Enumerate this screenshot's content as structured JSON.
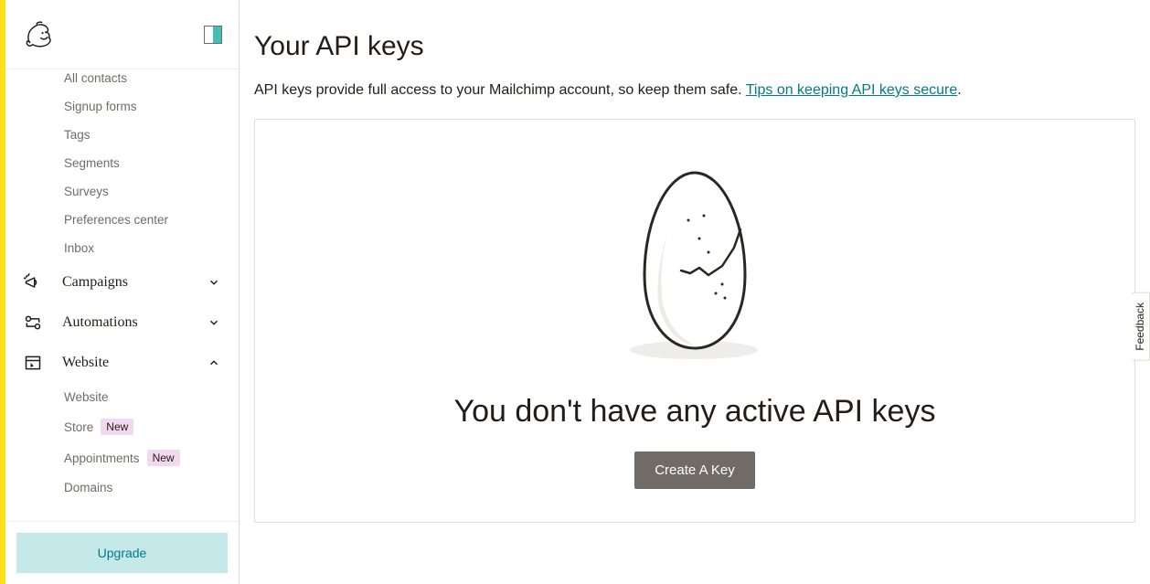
{
  "sidebar": {
    "sub_items_top": [
      {
        "label": "All contacts"
      },
      {
        "label": "Signup forms"
      },
      {
        "label": "Tags"
      },
      {
        "label": "Segments"
      },
      {
        "label": "Surveys"
      },
      {
        "label": "Preferences center"
      },
      {
        "label": "Inbox"
      }
    ],
    "nav": {
      "campaigns": "Campaigns",
      "automations": "Automations",
      "website": "Website"
    },
    "website_sub": [
      {
        "label": "Website",
        "badge": null
      },
      {
        "label": "Store",
        "badge": "New"
      },
      {
        "label": "Appointments",
        "badge": "New"
      },
      {
        "label": "Domains",
        "badge": null
      }
    ],
    "upgrade": "Upgrade"
  },
  "main": {
    "title": "Your API keys",
    "desc_prefix": "API keys provide full access to your Mailchimp account, so keep them safe. ",
    "desc_link": "Tips on keeping API keys secure",
    "desc_suffix": ".",
    "empty_heading": "You don't have any active API keys",
    "create_button": "Create A Key"
  },
  "feedback": "Feedback"
}
